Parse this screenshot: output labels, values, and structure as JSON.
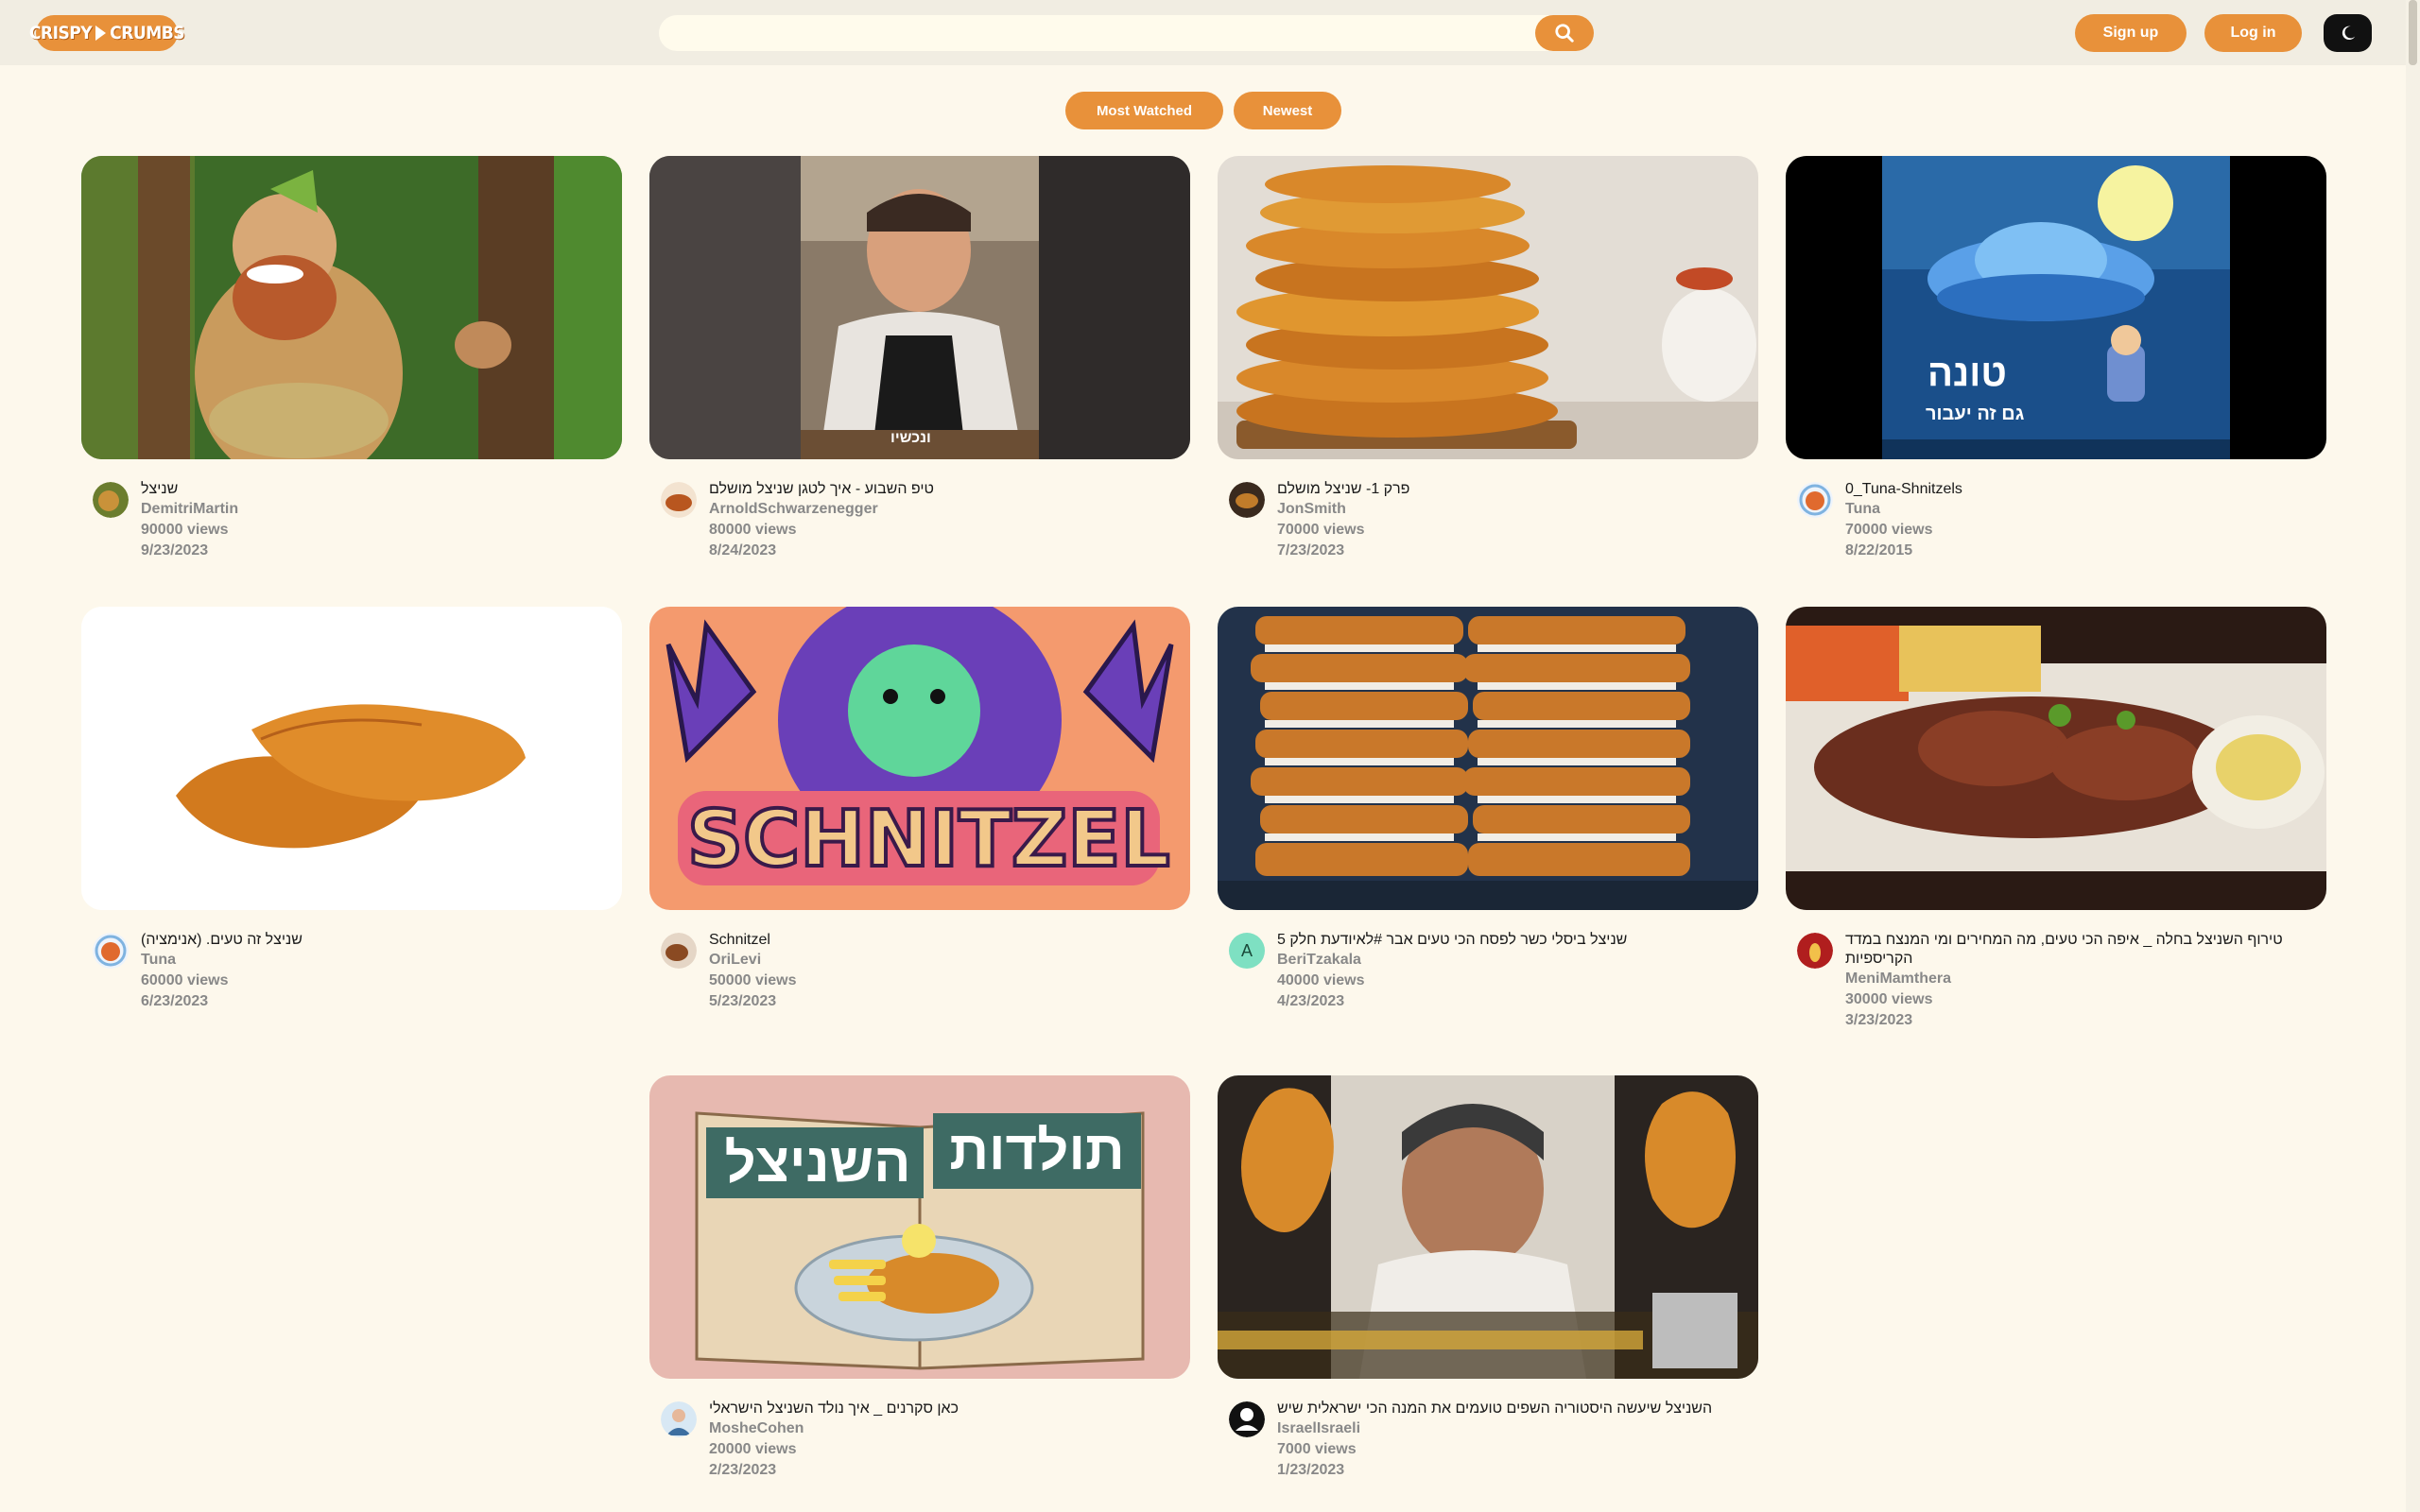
{
  "header": {
    "logo_left": "CRISPY",
    "logo_right": "CRUMBS",
    "search_placeholder": "",
    "signup_label": "Sign up",
    "login_label": "Log in"
  },
  "sort_tabs": [
    {
      "label": "Most Watched"
    },
    {
      "label": "Newest"
    }
  ],
  "videos": [
    {
      "title": "שניצל",
      "channel": "DemitriMartin",
      "views": "90000 views",
      "date": "9/23/2023"
    },
    {
      "title": "טיפ השבוע - איך לטגן שניצל מושלם",
      "channel": "ArnoldSchwarzenegger",
      "views": "80000 views",
      "date": "8/24/2023"
    },
    {
      "title": "פרק 1- שניצל מושלם",
      "channel": "JonSmith",
      "views": "70000 views",
      "date": "7/23/2023"
    },
    {
      "title": "0_Tuna-Shnitzels",
      "channel": "Tuna",
      "views": "70000 views",
      "date": "8/22/2015"
    },
    {
      "title": "שניצל זה טעים. (אנימציה)",
      "channel": "Tuna",
      "views": "60000 views",
      "date": "6/23/2023"
    },
    {
      "title": "Schnitzel",
      "channel": "OriLevi",
      "views": "50000 views",
      "date": "5/23/2023"
    },
    {
      "title": "שניצל ביסלי כשר לפסח הכי טעים אבר #לאיודעת חלק 5",
      "channel": "BeriTzakala",
      "views": "40000 views",
      "date": "4/23/2023"
    },
    {
      "title": "טירוף השניצל בחלה _ איפה הכי טעים, מה המחירים ומי המנצח במדד הקריספיות",
      "channel": "MeniMamthera",
      "views": "30000 views",
      "date": "3/23/2023"
    },
    {
      "title": "כאן סקרנים _ איך נולד השניצל הישראלי",
      "channel": "MosheCohen",
      "views": "20000 views",
      "date": "2/23/2023"
    },
    {
      "title": "השניצל שיעשה היסטוריה השפים טועמים את המנה הכי ישראלית שיש",
      "channel": "IsraelIsraeli",
      "views": "7000 views",
      "date": "1/23/2023"
    }
  ],
  "thumbnail_text": {
    "v2_caption": "ונכשיו",
    "v4_title": "טונה",
    "v4_sub": "גם זה יעבור",
    "v6_word": "SCHNITZEL",
    "v9_line1": "תולדות",
    "v9_line2": "השניצל"
  },
  "avatar_letters": {
    "v7": "A"
  },
  "colors": {
    "accent": "#e8913a",
    "background": "#fdf8ec",
    "header": "#f1ede2"
  }
}
